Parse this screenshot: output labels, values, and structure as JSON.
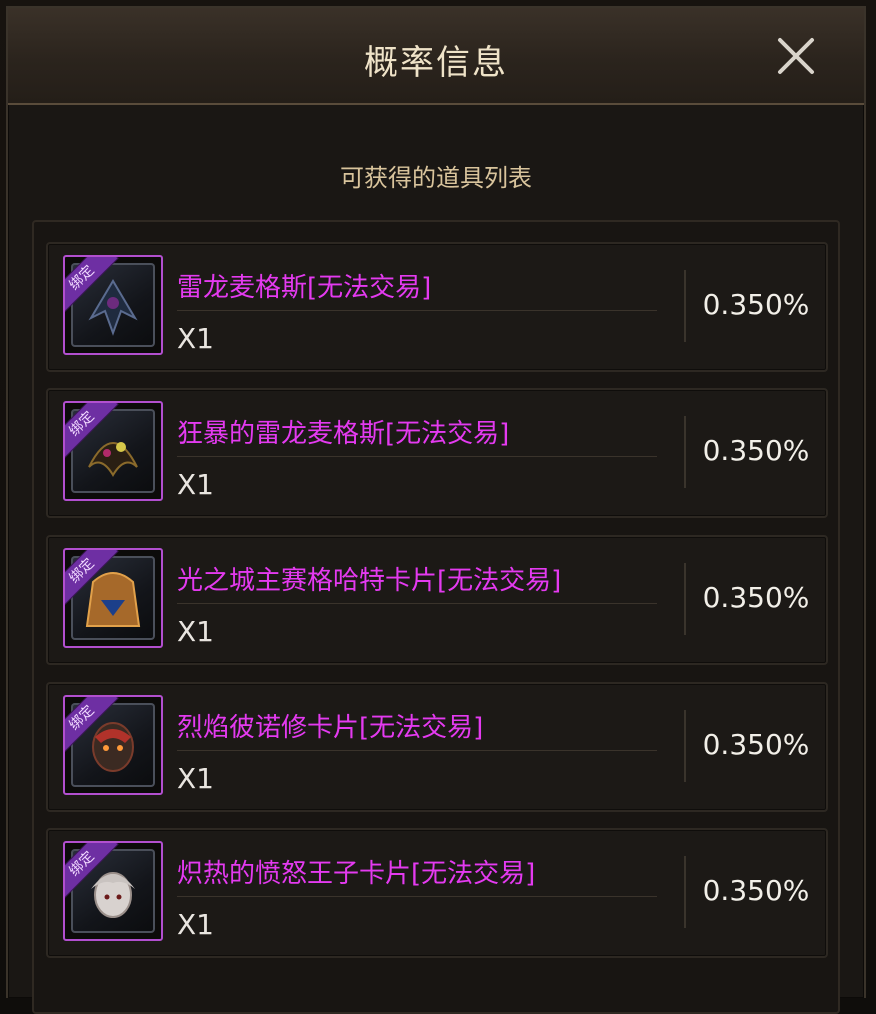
{
  "dialog": {
    "title": "概率信息",
    "subtitle": "可获得的道具列表"
  },
  "items": [
    {
      "name": "雷龙麦格斯[无法交易]",
      "qty": "X1",
      "prob": "0.350%",
      "badge": "绑定",
      "icon": "card-thunder-dragon-icon"
    },
    {
      "name": "狂暴的雷龙麦格斯[无法交易]",
      "qty": "X1",
      "prob": "0.350%",
      "badge": "绑定",
      "icon": "card-berserk-thunder-dragon-icon"
    },
    {
      "name": "光之城主赛格哈特卡片[无法交易]",
      "qty": "X1",
      "prob": "0.350%",
      "badge": "绑定",
      "icon": "card-light-city-lord-icon"
    },
    {
      "name": "烈焰彼诺修卡片[无法交易]",
      "qty": "X1",
      "prob": "0.350%",
      "badge": "绑定",
      "icon": "card-flame-pinoxiu-icon"
    },
    {
      "name": "炽热的愤怒王子卡片[无法交易]",
      "qty": "X1",
      "prob": "0.350%",
      "badge": "绑定",
      "icon": "card-blazing-angry-prince-icon"
    }
  ]
}
